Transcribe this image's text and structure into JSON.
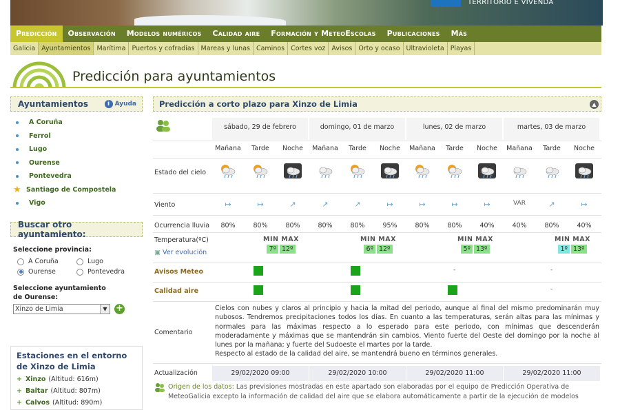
{
  "banner": {
    "ministry_text": "TERRITORIO E VIVENDA"
  },
  "main_nav": {
    "items": [
      "Predicción",
      "Observación",
      "Modelos numéricos",
      "Calidad aire",
      "Formación y MeteoEscolas",
      "Publicaciones",
      "Más"
    ],
    "active": "Predicción"
  },
  "sub_nav": {
    "items": [
      "Galicia",
      "Ayuntamientos",
      "Marítima",
      "Puertos y cofradías",
      "Mareas y lunas",
      "Caminos",
      "Cortes voz",
      "Avisos",
      "Orto y ocaso",
      "Ultravioleta",
      "Playas"
    ],
    "active": "Ayuntamientos"
  },
  "page_title": "Predicción para ayuntamientos",
  "sidebar": {
    "title": "Ayuntamientos",
    "help_label": "Ayuda",
    "municipalities": [
      {
        "name": "A Coruña",
        "marker": "dot"
      },
      {
        "name": "Ferrol",
        "marker": "dot"
      },
      {
        "name": "Lugo",
        "marker": "dot"
      },
      {
        "name": "Ourense",
        "marker": "dot"
      },
      {
        "name": "Pontevedra",
        "marker": "dot"
      },
      {
        "name": "Santiago de Compostela",
        "marker": "star"
      },
      {
        "name": "Vigo",
        "marker": "dot"
      }
    ],
    "search_title": "Buscar otro ayuntamiento:",
    "province_label": "Seleccione provincia:",
    "provinces": [
      {
        "name": "A Coruña",
        "selected": false
      },
      {
        "name": "Lugo",
        "selected": false
      },
      {
        "name": "Ourense",
        "selected": true
      },
      {
        "name": "Pontevedra",
        "selected": false
      }
    ],
    "municipality_label": "Seleccione ayuntamiento de Ourense:",
    "municipality_value": "Xinzo de Limia",
    "stations_title": "Estaciones en el entorno de Xinzo de Limia",
    "stations": [
      {
        "name": "Xinzo",
        "altitude": "(Altitud: 616m)"
      },
      {
        "name": "Baltar",
        "altitude": "(Altitud: 807m)"
      },
      {
        "name": "Calvos",
        "altitude": "(Altitud: 890m)"
      }
    ]
  },
  "forecast": {
    "title": "Predicción a corto plazo para Xinzo de Limia",
    "period_labels": [
      "Mañana",
      "Tarde",
      "Noche"
    ],
    "days": [
      {
        "label": "sábado, 29 de febrero",
        "min": "7º",
        "max": "12º",
        "min_color": "#8de08a",
        "max_color": "#8de08a",
        "alert": true,
        "air": true,
        "update": "29/02/2020 09:00"
      },
      {
        "label": "domingo, 01 de marzo",
        "min": "6º",
        "max": "12º",
        "min_color": "#8de08a",
        "max_color": "#8de08a",
        "alert": true,
        "air": true,
        "update": "29/02/2020 10:00"
      },
      {
        "label": "lunes, 02 de marzo",
        "min": "5º",
        "max": "13º",
        "min_color": "#8de08a",
        "max_color": "#8de08a",
        "alert": false,
        "air": true,
        "update": "29/02/2020 11:00"
      },
      {
        "label": "martes, 03 de marzo",
        "min": "1º",
        "max": "13º",
        "min_color": "#7ee8e0",
        "max_color": "#8de08a",
        "alert": false,
        "air": false,
        "update": "29/02/2020 11:00"
      }
    ],
    "row_labels": {
      "sky": "Estado del cielo",
      "wind": "Viento",
      "rain": "Ocurrencia lluvia",
      "temp": "Temperatura(ºC)",
      "evolution": "Ver evolución",
      "alerts": "Avisos Meteo",
      "air": "Calidad aire",
      "comment": "Comentario",
      "update": "Actualización"
    },
    "minmax_label": "MIN MAX",
    "dash": "-",
    "sky_icons": [
      "sun-cloud-rain-icon",
      "sun-cloud-rain-icon",
      "night-cloud-rain-icon",
      "cloud-rain-icon",
      "sun-cloud-rain-icon",
      "night-cloud-rain-icon",
      "sun-cloud-rain-icon",
      "sun-cloud-rain-icon",
      "night-cloud-rain-icon",
      "cloud-rain-icon",
      "cloud-rain-icon",
      "night-cloud-rain-icon"
    ],
    "wind": [
      "↦",
      "↦",
      "↗",
      "↗",
      "↗",
      "↦",
      "↦",
      "↦",
      "↦",
      "VAR",
      "↗",
      "↦"
    ],
    "rain": [
      "80%",
      "80%",
      "80%",
      "80%",
      "80%",
      "95%",
      "80%",
      "80%",
      "40%",
      "40%",
      "80%",
      "40%"
    ],
    "comment": "Cielos con nubes y claros al principio y hacia la mitad del periodo, aunque al final del mismo predominarán muy nubosos. Tendremos precipitaciones todos los días. En cuanto a las temperaturas, serán altas para las mínimas y normales para las máximas respecto a lo esperado para este periodo, con mínimas que descenderán moderadamente y máximas que se mantendrán sin cambios. Viento fuerte del Oeste del domingo por la noche al lunes por la mañana; y fuerte del Sudoeste el martes por la tarde.",
    "comment2": "Respecto al estado de la calidad del aire, se mantendrá bueno en términos generales.",
    "origin_label": "Origen de los datos:",
    "origin_text": "Las previsiones mostradas en este apartado son elaboradas por el equipo de Predicción Operativa de MeteoGalicia excepto la información de calidad del aire que se elabora automáticamente a partir de la ejecución de modelos"
  },
  "colors": {
    "nav": "#6a7d2a",
    "nav_active": "#c7c62f",
    "subnav": "#e6e3a8",
    "alert_green": "#1ca31c"
  }
}
